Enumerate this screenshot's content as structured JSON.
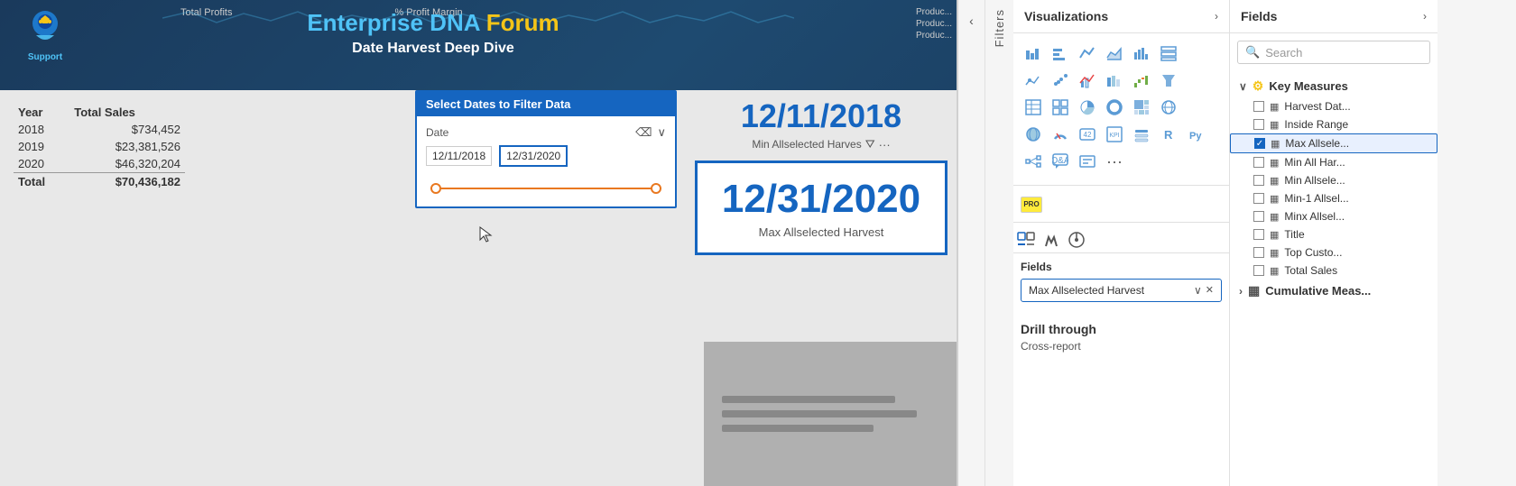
{
  "report": {
    "title": {
      "main_part1": "Enterprise DNA ",
      "main_part2": "Forum",
      "subtitle": "Date Harvest Deep Dive"
    },
    "logo_text": "Support",
    "top_labels": [
      "Total Profits",
      "% Profit Margin"
    ],
    "product_labels": [
      "Produc...",
      "Produc...",
      "Produc..."
    ],
    "sales_table": {
      "headers": [
        "Year",
        "Total Sales"
      ],
      "rows": [
        {
          "year": "2018",
          "sales": "$734,452"
        },
        {
          "year": "2019",
          "sales": "$23,381,526"
        },
        {
          "year": "2020",
          "sales": "$46,320,204"
        }
      ],
      "total_label": "Total",
      "total_value": "$70,436,182"
    },
    "date_filter": {
      "title": "Select Dates to Filter Data",
      "field_label": "Date",
      "start_date": "12/11/2018",
      "end_date": "12/31/2020"
    },
    "big_date_top": {
      "value": "12/11/2018",
      "label": "Min Allselected Harves"
    },
    "big_date_bottom": {
      "value": "12/31/2020",
      "label": "Max Allselected Harvest"
    }
  },
  "visualizations_panel": {
    "title": "Visualizations",
    "filters_label": "Filters",
    "tabs": [
      {
        "label": "Fields",
        "active": true
      },
      {
        "label": "Format"
      },
      {
        "label": "Analytics"
      }
    ],
    "fields_section": {
      "label": "Fields",
      "field": "Max Allselected Harvest"
    },
    "drill_through": {
      "label": "Drill through",
      "sublabel": "Cross-report"
    }
  },
  "fields_panel": {
    "title": "Fields",
    "search": {
      "placeholder": "Search"
    },
    "groups": [
      {
        "name": "Key Measures",
        "items": [
          {
            "name": "Harvest Dat...",
            "checked": false,
            "type": "calc"
          },
          {
            "name": "Inside Range",
            "checked": false,
            "type": "calc"
          },
          {
            "name": "Max Allsele...",
            "checked": true,
            "type": "calc",
            "highlighted": true
          },
          {
            "name": "Min All Har...",
            "checked": false,
            "type": "calc"
          },
          {
            "name": "Min Allsele...",
            "checked": false,
            "type": "calc"
          },
          {
            "name": "Min-1 Allsel...",
            "checked": false,
            "type": "calc"
          },
          {
            "name": "Minx Allsel...",
            "checked": false,
            "type": "calc"
          },
          {
            "name": "Title",
            "checked": false,
            "type": "calc"
          },
          {
            "name": "Top Custo...",
            "checked": false,
            "type": "calc"
          },
          {
            "name": "Total Sales",
            "checked": false,
            "type": "calc"
          }
        ]
      },
      {
        "name": "Cumulative Meas...",
        "items": []
      }
    ]
  },
  "icons": {
    "collapse_left": "‹",
    "collapse_right": "›",
    "search": "🔍",
    "chevron_down": "∨",
    "chevron_right": "›",
    "close": "✕",
    "check": "✓",
    "calculator": "fx",
    "filter_funnel": "⛛",
    "expand": "⊞"
  }
}
